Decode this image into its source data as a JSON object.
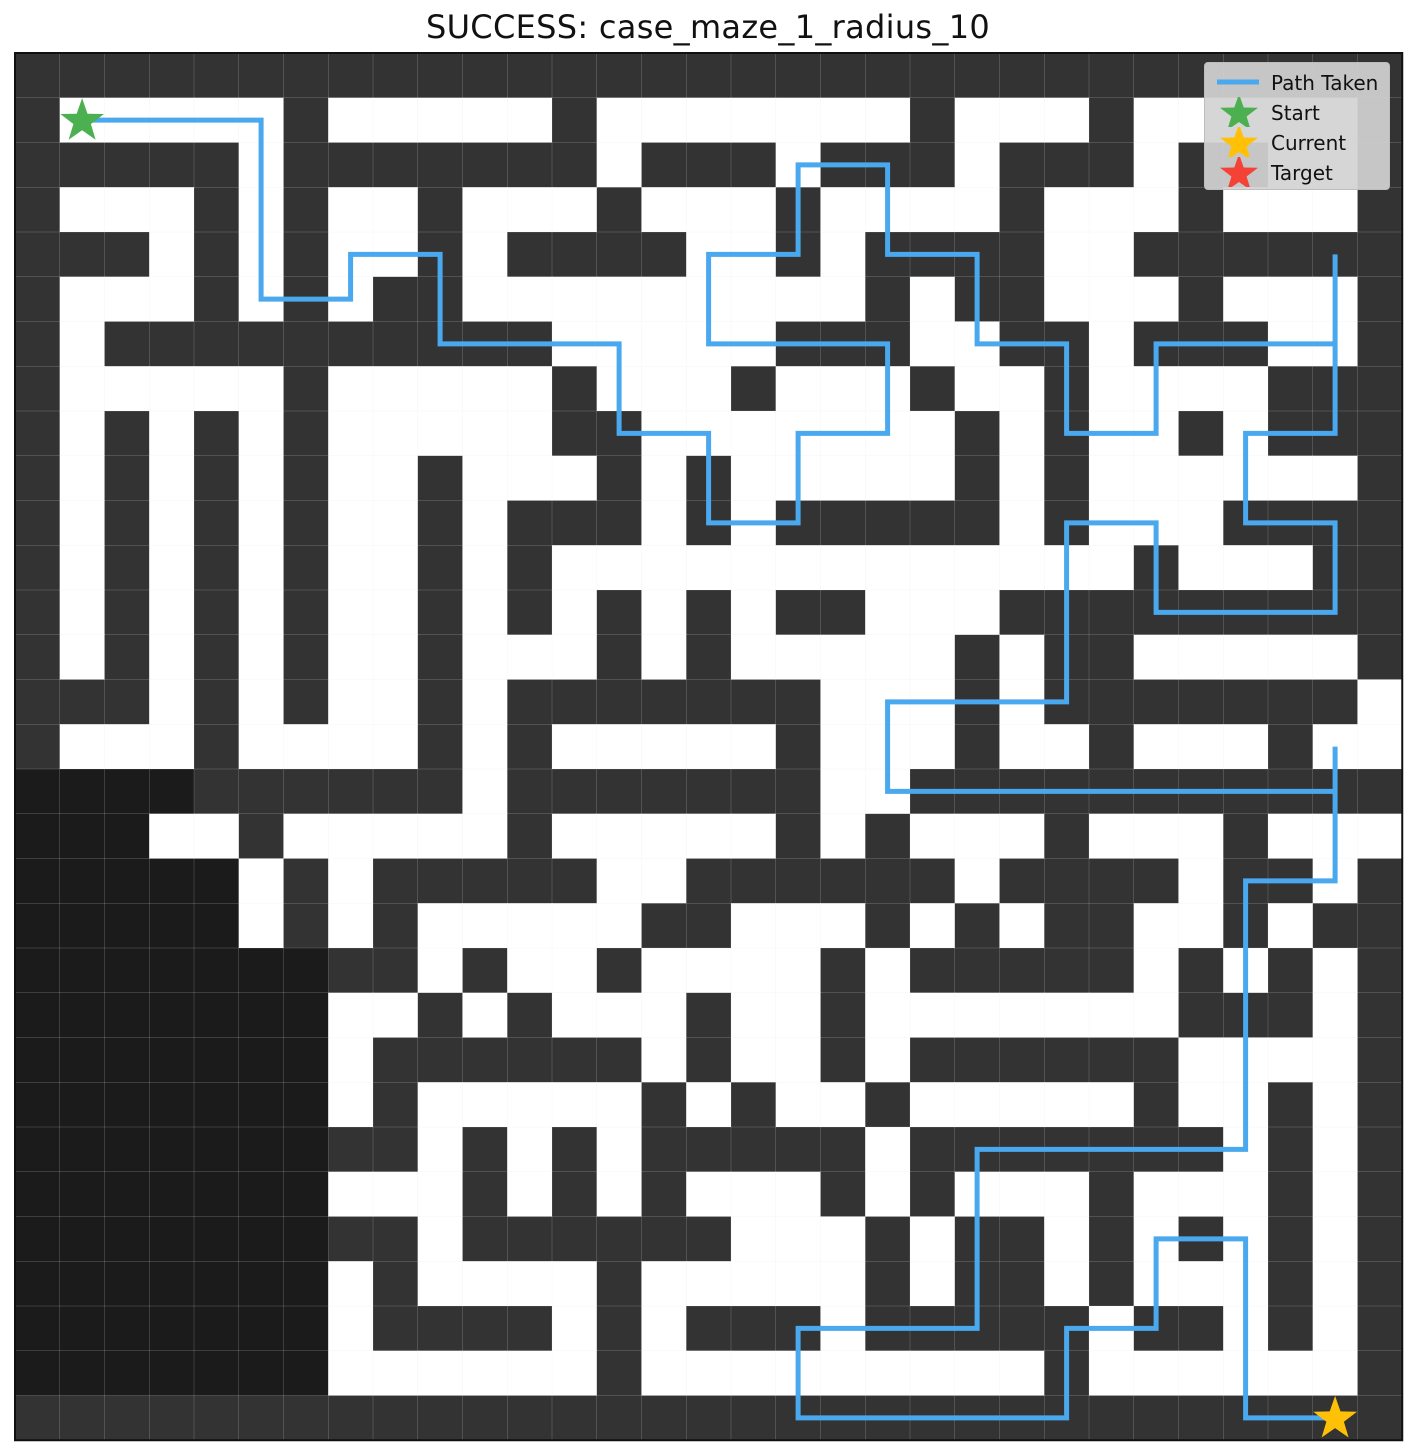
{
  "title": "SUCCESS: case_maze_1_radius_10",
  "colors": {
    "wall": "#333333",
    "open": "#ffffff",
    "unknown": "#1b1b1b",
    "path": "#4aa8ef",
    "start": "#4cb050",
    "current": "#ffc107",
    "target": "#f44336",
    "grid": "#e6e6e6"
  },
  "legend": {
    "items": [
      {
        "label": "Path Taken",
        "symbol": "line"
      },
      {
        "label": "Start",
        "symbol": "star-green"
      },
      {
        "label": "Current",
        "symbol": "star-yellow"
      },
      {
        "label": "Target",
        "symbol": "star-red"
      }
    ]
  },
  "maze": {
    "rows": 31,
    "cols": 31,
    "grid": [
      "###############################",
      "#.....#.....#.......#...#.....#",
      "#####.#######.###.###.###.##..#",
      "#...#.#..#...#...#....#...#...#",
      "###.#.#..#.####..#.####..######",
      "#...#.#.##.........#.##...#...#",
      "#.##########.....###..##.###..#",
      "#.....#.....#...#...#..#....###",
      "#.#.#.#.....##.......#.#..#.###",
      "#.#.#.#..#...#.#.....#.#......#",
      "#.#.#.#..#.###.#.#####.#...####",
      "#.#.#.#..#.#.............#...##",
      "#.#.#.#..#.#.#.#.##...#########",
      "#.#.#.#..#...#.#.....#.##.....#",
      "###.#.#..#.#######...#.#######.",
      "#...#....#.#.....#...#..#...#..",
      "????######.#######..###########",
      "???..#.....#.....#.#...#...#...",
      "?????.#.#####..######.####.##.#",
      "?????.#.#.....##...#.#.##..#.##",
      "???????##.#..#....#.#####.#.#.#",
      "???????..#.#...#..#.......###.#",
      "???????.######.#..#.######....#",
      "???????.#.....#.#..#.....#..#.#",
      "???????##.#.#.#####.#######.#.#",
      "???????...#.#.#...#.#...#...#.#",
      "???????##.######...#.##.#.#.#.#",
      "???????.#....#.....#.##.#...#.#",
      "???????.####.#.###.#####.##.#.#",
      "???????......#.........#......#",
      "###############################"
    ],
    "path": [
      [
        1,
        1
      ],
      [
        5,
        1
      ],
      [
        5,
        5
      ],
      [
        7,
        5
      ],
      [
        7,
        4
      ],
      [
        9,
        4
      ],
      [
        9,
        6
      ],
      [
        13,
        6
      ],
      [
        13,
        8
      ],
      [
        15,
        8
      ],
      [
        15,
        10
      ],
      [
        17,
        10
      ],
      [
        17,
        8
      ],
      [
        19,
        8
      ],
      [
        19,
        6
      ],
      [
        15,
        6
      ],
      [
        15,
        4
      ],
      [
        17,
        4
      ],
      [
        17,
        2
      ],
      [
        19,
        2
      ],
      [
        19,
        4
      ],
      [
        21,
        4
      ],
      [
        21,
        6
      ],
      [
        23,
        6
      ],
      [
        23,
        8
      ],
      [
        25,
        8
      ],
      [
        25,
        6
      ],
      [
        29,
        6
      ],
      [
        29,
        4
      ],
      [
        29,
        8
      ],
      [
        27,
        8
      ],
      [
        27,
        10
      ],
      [
        29,
        10
      ],
      [
        29,
        12
      ],
      [
        25,
        12
      ],
      [
        25,
        10
      ],
      [
        23,
        10
      ],
      [
        23,
        14
      ],
      [
        19,
        14
      ],
      [
        19,
        16
      ],
      [
        29,
        16
      ],
      [
        29,
        15
      ],
      [
        29,
        18
      ],
      [
        27,
        18
      ],
      [
        27,
        24
      ],
      [
        21,
        24
      ],
      [
        21,
        28
      ],
      [
        17,
        28
      ],
      [
        17,
        30
      ],
      [
        23,
        30
      ],
      [
        23,
        28
      ],
      [
        25,
        28
      ],
      [
        25,
        26
      ],
      [
        27,
        26
      ],
      [
        27,
        30
      ],
      [
        29,
        30
      ]
    ],
    "start": [
      1,
      1
    ],
    "current": [
      29,
      30
    ]
  }
}
